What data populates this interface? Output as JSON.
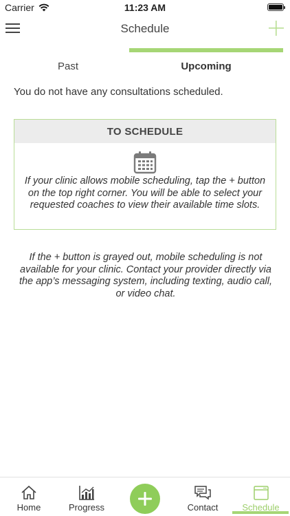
{
  "status_bar": {
    "carrier": "Carrier",
    "time": "11:23 AM"
  },
  "header": {
    "title": "Schedule"
  },
  "tabs": [
    {
      "label": "Past",
      "active": false
    },
    {
      "label": "Upcoming",
      "active": true
    }
  ],
  "main": {
    "empty_message": "You do not have any consultations scheduled.",
    "schedule_box": {
      "title": "TO SCHEDULE",
      "icon": "calendar-icon",
      "text": "If your clinic allows mobile scheduling, tap the + button on the top right corner. You will be able to select your requested coaches to view their available time slots."
    },
    "note": "If the + button is grayed out, mobile scheduling is not available for your clinic. Contact your provider directly via the app’s messaging system, including texting, audio call, or video chat."
  },
  "tab_bar": {
    "items": [
      {
        "label": "Home",
        "icon": "home-icon"
      },
      {
        "label": "Progress",
        "icon": "progress-chart-icon"
      },
      {
        "label": "Contact",
        "icon": "chat-bubbles-icon"
      },
      {
        "label": "Schedule",
        "icon": "calendar-icon",
        "active": true
      }
    ]
  },
  "colors": {
    "accent": "#a6d675",
    "fab": "#8fcd5a",
    "header_bg": "#ececec"
  }
}
